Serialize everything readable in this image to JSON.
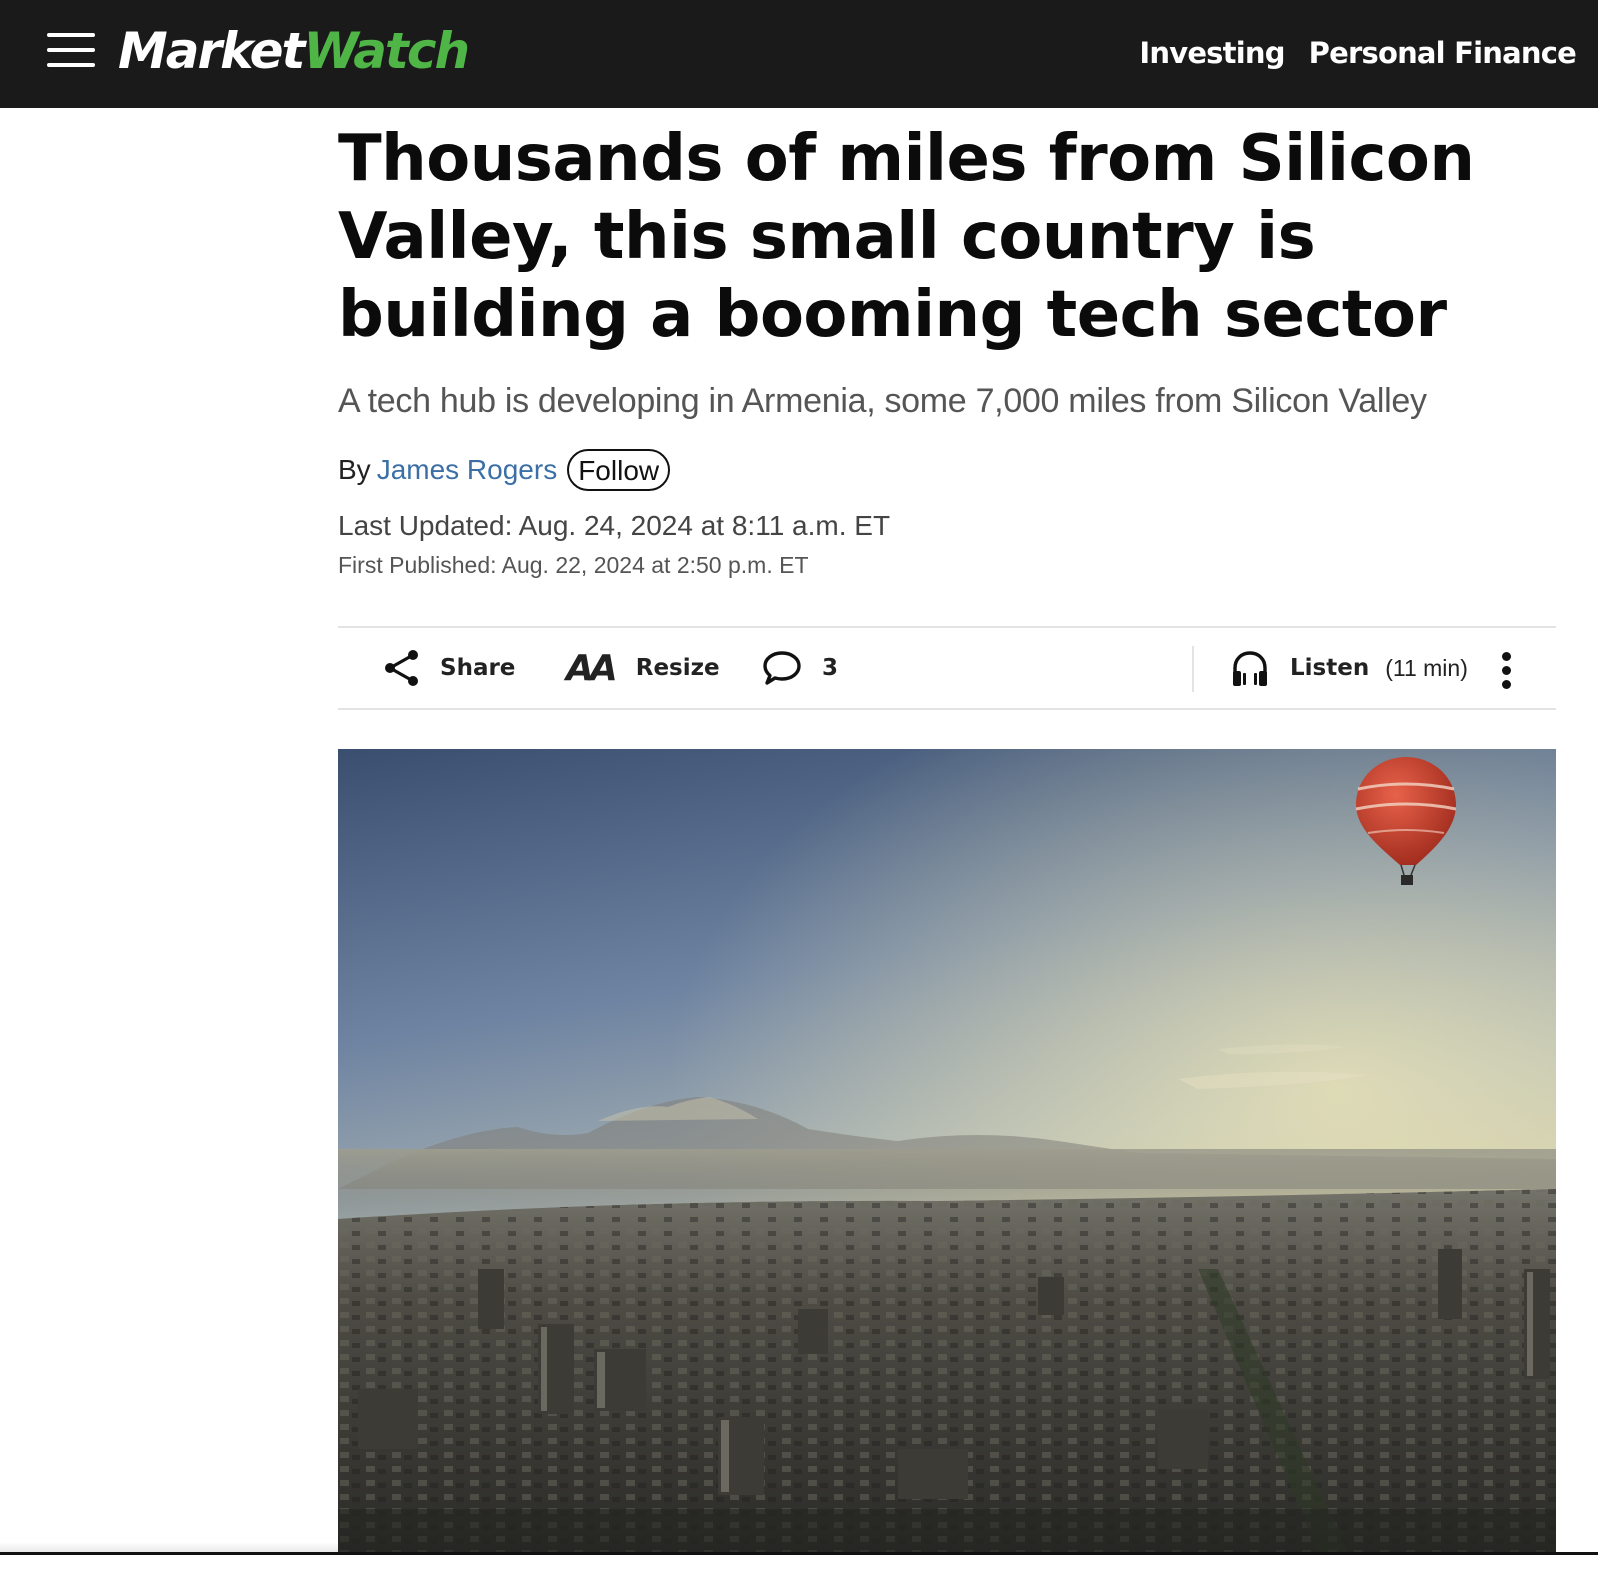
{
  "brand": {
    "logo_part1": "Market",
    "logo_part2": "Watch",
    "logo_accent_color": "#4fb547",
    "header_bg": "#1a1a1a"
  },
  "nav": {
    "links": [
      "Investing",
      "Personal Finance"
    ]
  },
  "article": {
    "headline": "Thousands of miles from Silicon Valley, this small country is building a booming tech sector",
    "dek": "A tech hub is developing in Armenia, some 7,000 miles from Silicon Valley",
    "byline_prefix": "By",
    "author": "James Rogers",
    "follow_label": "Follow",
    "last_updated": "Last Updated: Aug. 24, 2024 at 8:11 a.m. ET",
    "first_published": "First Published: Aug. 22, 2024 at 2:50 p.m. ET",
    "author_link_color": "#3b6fa6"
  },
  "tools": {
    "share_label": "Share",
    "resize_icon_text": "AA",
    "resize_label": "Resize",
    "comment_count": "3",
    "listen_label": "Listen",
    "listen_duration": "(11 min)"
  },
  "icons": {
    "menu": "hamburger-icon",
    "share": "share-icon",
    "resize": "text-resize-icon",
    "comments": "comment-bubble-icon",
    "listen": "headphones-icon",
    "more": "vertical-dots-icon"
  }
}
